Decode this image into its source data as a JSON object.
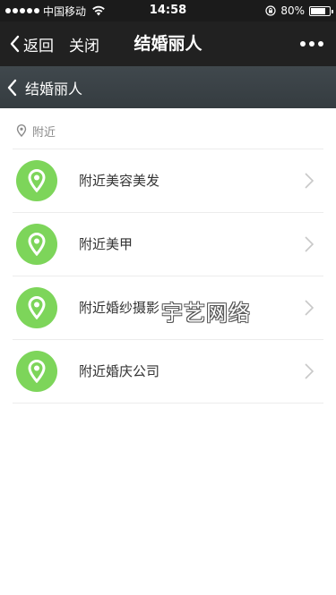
{
  "status_bar": {
    "carrier": "中国移动",
    "time": "14:58",
    "battery_percent_text": "80%",
    "battery_level": 0.8
  },
  "nav_bar": {
    "back_label": "返回",
    "close_label": "关闭",
    "title": "结婚丽人"
  },
  "sub_header": {
    "title": "结婚丽人"
  },
  "section": {
    "label": "附近"
  },
  "list": {
    "items": [
      {
        "label": "附近美容美发"
      },
      {
        "label": "附近美甲"
      },
      {
        "label": "附近婚纱摄影"
      },
      {
        "label": "附近婚庆公司"
      }
    ]
  },
  "watermark": {
    "text": "宇艺网络"
  },
  "colors": {
    "accent_green": "#7dd55a",
    "nav_bg": "#212121",
    "sub_header_bg": "#3b4247"
  }
}
